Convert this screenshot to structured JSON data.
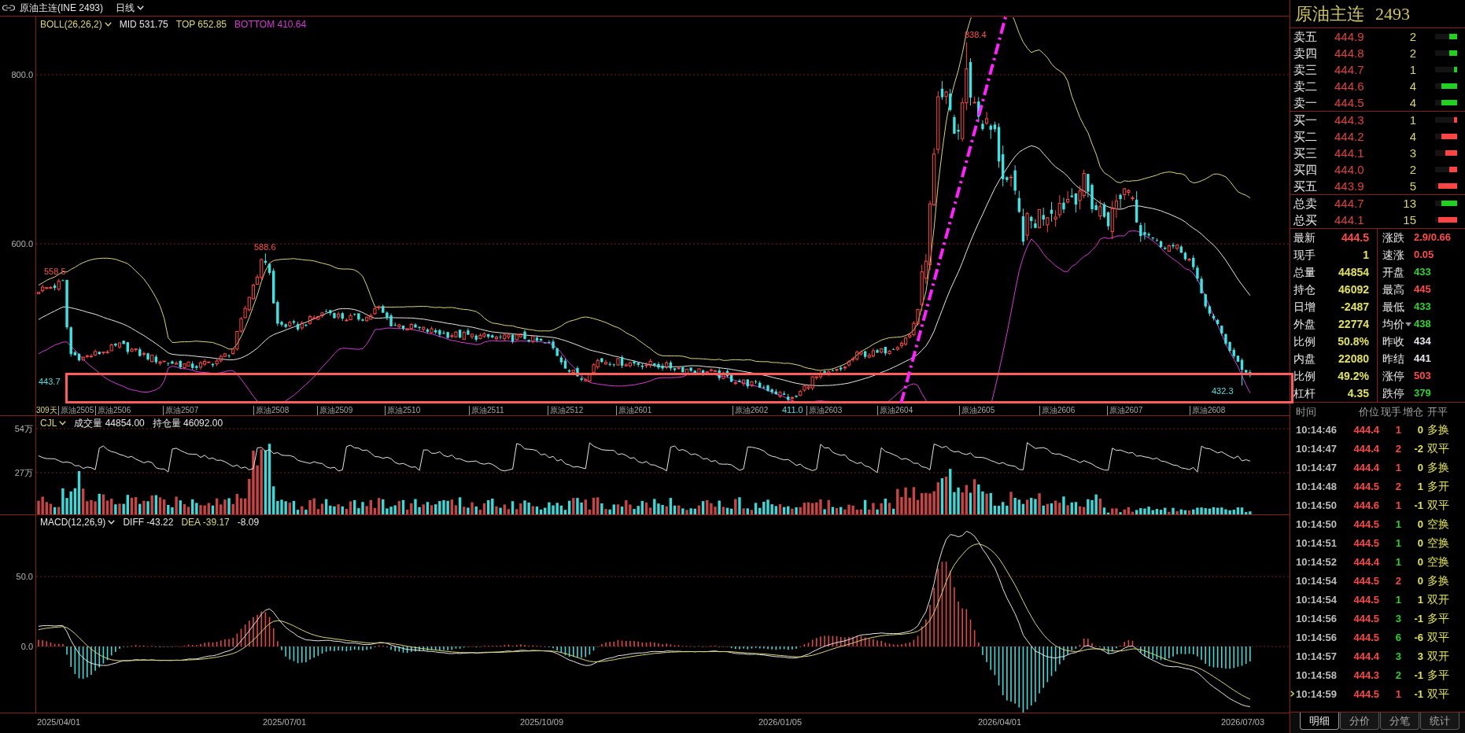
{
  "header": {
    "title": "原油主连(INE 2493)",
    "period": "日线"
  },
  "price_panel": {
    "indicator": "BOLL(26,26,2)",
    "readouts": [
      {
        "text": "MID 531.75",
        "color": "#e6e6e6"
      },
      {
        "text": "TOP 652.85",
        "color": "#d9d57a"
      },
      {
        "text": "BOTTOM 410.64",
        "color": "#d83ad8"
      }
    ],
    "y_ticks": [
      "800.0",
      "600.0"
    ],
    "span_label": "309天",
    "contracts": [
      "原油2505",
      "原油2506",
      "原油2507",
      "原油2508",
      "原油2509",
      "原油2510",
      "原油2511",
      "原油2512",
      "原油2601",
      "原油2602",
      "原油2603",
      "原油2604",
      "原油2605",
      "原油2606",
      "原油2607",
      "原油2608"
    ],
    "price_marks": [
      {
        "text": "558.5",
        "kind": "high"
      },
      {
        "text": "588.6",
        "kind": "high"
      },
      {
        "text": "838.4",
        "kind": "high"
      },
      {
        "text": "443.7",
        "kind": "low"
      },
      {
        "text": "411.0",
        "kind": "low"
      },
      {
        "text": "432.3",
        "kind": "low"
      }
    ]
  },
  "volume_panel": {
    "indicator": "CJL",
    "readouts": [
      "成交量 44854.00",
      "持仓量 46092.00"
    ],
    "y_ticks": [
      "54万",
      "27万"
    ]
  },
  "macd_panel": {
    "indicator": "MACD(12,26,9)",
    "readouts": [
      {
        "text": "DIFF -43.22",
        "color": "#e6e6e6"
      },
      {
        "text": "DEA -39.17",
        "color": "#d9d57a"
      },
      {
        "text": "-8.09",
        "color": "#e6e6e6"
      }
    ],
    "y_ticks": [
      "50.0",
      "0.0"
    ]
  },
  "date_axis": [
    "2025/04/01",
    "2025/07/01",
    "2025/10/09",
    "2026/01/05",
    "2026/04/01",
    "2026/07/03"
  ],
  "quote": {
    "name": "原油主连",
    "code": "2493",
    "asks": [
      {
        "label": "卖五",
        "price": "444.9",
        "qty": "2",
        "level": 0.34
      },
      {
        "label": "卖四",
        "price": "444.8",
        "qty": "2",
        "level": 0.34
      },
      {
        "label": "卖三",
        "price": "444.7",
        "qty": "1",
        "level": 0.16
      },
      {
        "label": "卖二",
        "price": "444.6",
        "qty": "4",
        "level": 0.7
      },
      {
        "label": "卖一",
        "price": "444.5",
        "qty": "4",
        "level": 0.7
      }
    ],
    "bids": [
      {
        "label": "买一",
        "price": "444.3",
        "qty": "1",
        "level": 0.16
      },
      {
        "label": "买二",
        "price": "444.2",
        "qty": "4",
        "level": 0.7
      },
      {
        "label": "买三",
        "price": "444.1",
        "qty": "3",
        "level": 0.52
      },
      {
        "label": "买四",
        "price": "444.0",
        "qty": "2",
        "level": 0.34
      },
      {
        "label": "买五",
        "price": "443.9",
        "qty": "5",
        "level": 0.86
      }
    ],
    "totals": [
      {
        "label": "总卖",
        "price": "444.7",
        "qty": "13",
        "level": 0.71,
        "kind": "sell"
      },
      {
        "label": "总买",
        "price": "444.1",
        "qty": "15",
        "level": 0.86,
        "kind": "buy"
      }
    ],
    "stats": [
      {
        "label": "最新",
        "value": "444.5",
        "color": "#ff4a4a",
        "dropdown": false
      },
      {
        "label": "涨跌",
        "value": "2.9/0.66",
        "color": "#ff4a4a",
        "dropdown": false
      },
      {
        "label": "现手",
        "value": "1",
        "color": "#e2e25a",
        "dropdown": false
      },
      {
        "label": "速涨",
        "value": "0.05",
        "color": "#ff4a4a",
        "dropdown": false
      },
      {
        "label": "总量",
        "value": "44854",
        "color": "#e2e25a",
        "dropdown": false
      },
      {
        "label": "开盘",
        "value": "433",
        "color": "#2fd02f",
        "dropdown": false
      },
      {
        "label": "持仓",
        "value": "46092",
        "color": "#e2e25a",
        "dropdown": false
      },
      {
        "label": "最高",
        "value": "445",
        "color": "#ff4a4a",
        "dropdown": false
      },
      {
        "label": "日增",
        "value": "-2487",
        "color": "#e2e25a",
        "dropdown": false
      },
      {
        "label": "最低",
        "value": "433",
        "color": "#2fd02f",
        "dropdown": false
      },
      {
        "label": "外盘",
        "value": "22774",
        "color": "#e2e25a",
        "dropdown": false
      },
      {
        "label": "均价",
        "value": "438",
        "color": "#2fd02f",
        "dropdown": true
      },
      {
        "label": "比例",
        "value": "50.8%",
        "color": "#e2e25a",
        "dropdown": false
      },
      {
        "label": "昨收",
        "value": "434",
        "color": "#e6e6f0",
        "dropdown": false
      },
      {
        "label": "内盘",
        "value": "22080",
        "color": "#e2e25a",
        "dropdown": false
      },
      {
        "label": "昨结",
        "value": "441",
        "color": "#e6e6f0",
        "dropdown": false
      },
      {
        "label": "比例",
        "value": "49.2%",
        "color": "#e2e25a",
        "dropdown": false
      },
      {
        "label": "涨停",
        "value": "503",
        "color": "#ff4a4a",
        "dropdown": false
      },
      {
        "label": "杠杆",
        "value": "4.35",
        "color": "#e2e25a",
        "dropdown": false
      },
      {
        "label": "跌停",
        "value": "379",
        "color": "#2fd02f",
        "dropdown": false
      }
    ]
  },
  "trades": {
    "columns": [
      "时间",
      "价位",
      "现手",
      "增仓",
      "开平"
    ],
    "rows": [
      {
        "time": "10:14:46",
        "price": "444.4",
        "hand": "1",
        "color": "#ff4646",
        "change": "0",
        "type": "多换",
        "selected": false
      },
      {
        "time": "10:14:47",
        "price": "444.4",
        "hand": "2",
        "color": "#ff4646",
        "change": "-2",
        "type": "双平",
        "selected": false
      },
      {
        "time": "10:14:47",
        "price": "444.4",
        "hand": "1",
        "color": "#ff4646",
        "change": "0",
        "type": "多换",
        "selected": false
      },
      {
        "time": "10:14:48",
        "price": "444.5",
        "hand": "2",
        "color": "#ff4646",
        "change": "1",
        "type": "多开",
        "selected": false
      },
      {
        "time": "10:14:50",
        "price": "444.6",
        "hand": "1",
        "color": "#ff4646",
        "change": "-1",
        "type": "双平",
        "selected": false
      },
      {
        "time": "10:14:50",
        "price": "444.5",
        "hand": "1",
        "color": "#2fd02f",
        "change": "0",
        "type": "空换",
        "selected": false
      },
      {
        "time": "10:14:51",
        "price": "444.5",
        "hand": "1",
        "color": "#2fd02f",
        "change": "0",
        "type": "空换",
        "selected": false
      },
      {
        "time": "10:14:52",
        "price": "444.4",
        "hand": "1",
        "color": "#2fd02f",
        "change": "0",
        "type": "空换",
        "selected": false
      },
      {
        "time": "10:14:54",
        "price": "444.5",
        "hand": "2",
        "color": "#ff4646",
        "change": "0",
        "type": "多换",
        "selected": false
      },
      {
        "time": "10:14:54",
        "price": "444.5",
        "hand": "1",
        "color": "#2fd02f",
        "change": "1",
        "type": "双开",
        "selected": false
      },
      {
        "time": "10:14:56",
        "price": "444.5",
        "hand": "3",
        "color": "#2fd02f",
        "change": "-1",
        "type": "多平",
        "selected": false
      },
      {
        "time": "10:14:56",
        "price": "444.5",
        "hand": "6",
        "color": "#2fd02f",
        "change": "-6",
        "type": "双平",
        "selected": false
      },
      {
        "time": "10:14:57",
        "price": "444.4",
        "hand": "3",
        "color": "#2fd02f",
        "change": "3",
        "type": "双开",
        "selected": false
      },
      {
        "time": "10:14:58",
        "price": "444.3",
        "hand": "2",
        "color": "#2fd02f",
        "change": "-1",
        "type": "多平",
        "selected": false
      },
      {
        "time": "10:14:59",
        "price": "444.5",
        "hand": "1",
        "color": "#ff4646",
        "change": "-1",
        "type": "双平",
        "selected": true
      }
    ]
  },
  "tabs": [
    {
      "label": "明细",
      "selected": true
    },
    {
      "label": "分价",
      "selected": false
    },
    {
      "label": "分笔",
      "selected": false
    },
    {
      "label": "统计",
      "selected": false
    }
  ]
}
